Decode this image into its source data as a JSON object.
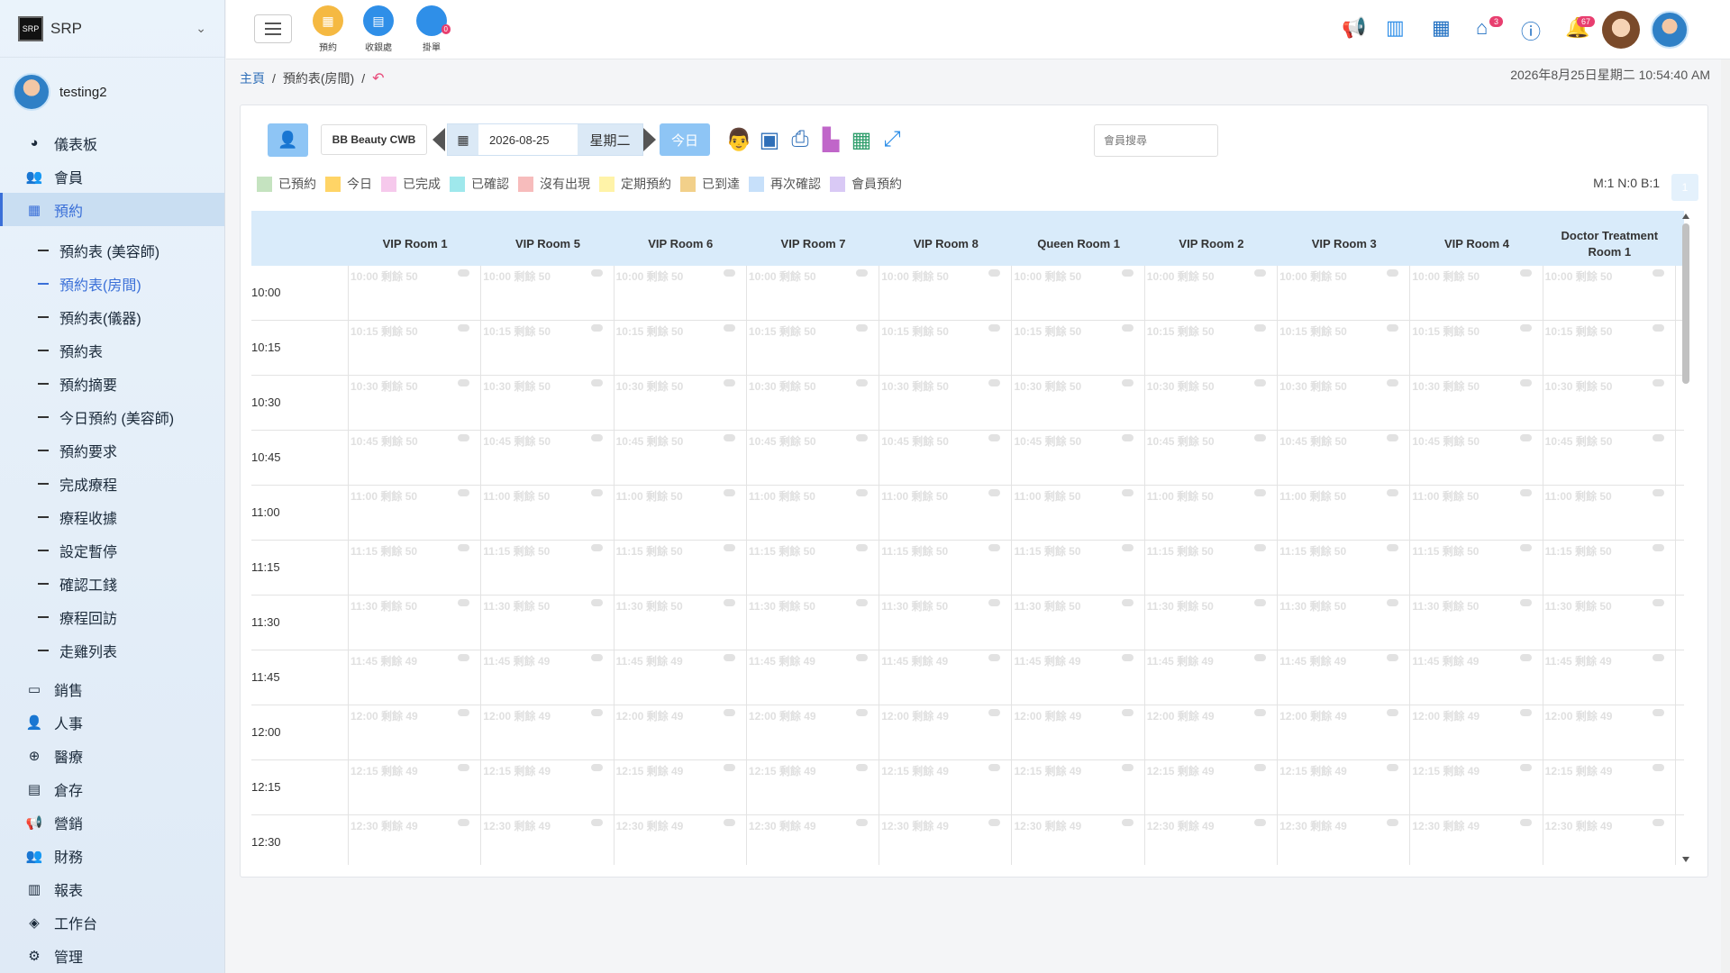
{
  "brand": {
    "logo": "SRP",
    "name": "SRP"
  },
  "user": {
    "name": "testing2"
  },
  "nav": {
    "top": [
      {
        "label": "儀表板",
        "icon": "pie-chart-icon",
        "glyph": "◕"
      },
      {
        "label": "會員",
        "icon": "users-icon",
        "glyph": "👥"
      },
      {
        "label": "預約",
        "icon": "calendar-icon",
        "glyph": "▦"
      }
    ],
    "sub": [
      "預約表 (美容師)",
      "預約表(房間)",
      "預約表(儀器)",
      "預約表",
      "預約摘要",
      "今日預約 (美容師)",
      "預約要求",
      "完成療程",
      "療程收據",
      "設定暫停",
      "確認工錢",
      "療程回訪",
      "走雞列表"
    ],
    "bottom": [
      {
        "label": "銷售",
        "icon": "sales-card-icon",
        "glyph": "▭"
      },
      {
        "label": "人事",
        "icon": "person-icon",
        "glyph": "👤"
      },
      {
        "label": "醫療",
        "icon": "medical-icon",
        "glyph": "⊕"
      },
      {
        "label": "倉存",
        "icon": "warehouse-icon",
        "glyph": "▤"
      },
      {
        "label": "營銷",
        "icon": "megaphone-icon",
        "glyph": "📢"
      },
      {
        "label": "財務",
        "icon": "finance-users-icon",
        "glyph": "👥"
      },
      {
        "label": "報表",
        "icon": "bar-chart-icon",
        "glyph": "▥"
      },
      {
        "label": "工作台",
        "icon": "layers-icon",
        "glyph": "◈"
      },
      {
        "label": "管理",
        "icon": "gear-icon",
        "glyph": "⚙"
      }
    ]
  },
  "quick": [
    {
      "label": "預約",
      "color": "#f5b942",
      "glyph": "▦"
    },
    {
      "label": "收銀處",
      "color": "#2f8fe8",
      "glyph": "▤"
    },
    {
      "label": "掛單",
      "color": "#2f8fe8",
      "glyph": "",
      "badge": "0"
    }
  ],
  "topright": {
    "cake_badge": "3",
    "bell_badge": "67"
  },
  "breadcrumb": {
    "home": "主頁",
    "sep1": "/",
    "current": "預約表(房間)",
    "sep2": "/"
  },
  "datetime": "2026年8月25日星期二 10:54:40 AM",
  "toolbar": {
    "shop": "BB Beauty CWB",
    "date": "2026-08-25",
    "weekday": "星期二",
    "today": "今日"
  },
  "search": {
    "placeholder": "會員搜尋"
  },
  "legend": [
    {
      "label": "已預約",
      "color": "#c5e3c0"
    },
    {
      "label": "今日",
      "color": "#ffd466"
    },
    {
      "label": "已完成",
      "color": "#f6c9ec"
    },
    {
      "label": "已確認",
      "color": "#9fe8ec"
    },
    {
      "label": "沒有出現",
      "color": "#f7bcbc"
    },
    {
      "label": "定期預約",
      "color": "#fff3a8"
    },
    {
      "label": "已到達",
      "color": "#f2d08a"
    },
    {
      "label": "再次確認",
      "color": "#c7e0fa"
    },
    {
      "label": "會員預約",
      "color": "#d9c9f5"
    }
  ],
  "counts": "M:1 N:0 B:1",
  "counts_button": "1",
  "rooms": [
    "VIP Room 1",
    "VIP Room 5",
    "VIP Room 6",
    "VIP Room 7",
    "VIP Room 8",
    "Queen Room 1",
    "VIP Room 2",
    "VIP Room 3",
    "VIP Room 4",
    "Doctor Treatment Room 1"
  ],
  "slots": [
    {
      "time": "10:00",
      "remain": "10:00 剩餘 50"
    },
    {
      "time": "10:15",
      "remain": "10:15 剩餘 50"
    },
    {
      "time": "10:30",
      "remain": "10:30 剩餘 50"
    },
    {
      "time": "10:45",
      "remain": "10:45 剩餘 50"
    },
    {
      "time": "11:00",
      "remain": "11:00 剩餘 50"
    },
    {
      "time": "11:15",
      "remain": "11:15 剩餘 50"
    },
    {
      "time": "11:30",
      "remain": "11:30 剩餘 50"
    },
    {
      "time": "11:45",
      "remain": "11:45 剩餘 49"
    },
    {
      "time": "12:00",
      "remain": "12:00 剩餘 49"
    },
    {
      "time": "12:15",
      "remain": "12:15 剩餘 49"
    },
    {
      "time": "12:30",
      "remain": "12:30 剩餘 49"
    }
  ]
}
